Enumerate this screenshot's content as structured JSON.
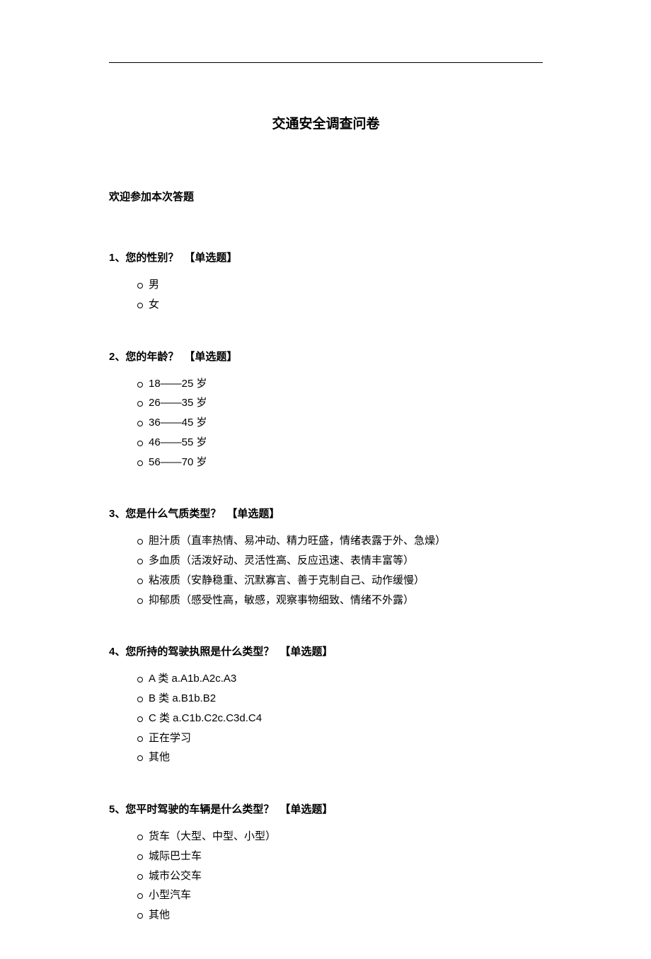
{
  "title": "交通安全调查问卷",
  "intro": "欢迎参加本次答题",
  "questions": [
    {
      "number": "1、",
      "text": "您的性别？",
      "tag": "【单选题】",
      "options": [
        "男",
        "女"
      ]
    },
    {
      "number": "2、",
      "text": "您的年龄？",
      "tag": "【单选题】",
      "options": [
        "18——25 岁",
        "26——35 岁",
        "36——45 岁",
        "46——55 岁",
        "56——70 岁"
      ]
    },
    {
      "number": "3、",
      "text": "您是什么气质类型？",
      "tag": "【单选题】",
      "options": [
        "胆汁质（直率热情、易冲动、精力旺盛，情绪表露于外、急燥）",
        "多血质（活泼好动、灵活性高、反应迅速、表情丰富等）",
        "粘液质（安静稳重、沉默寡言、善于克制自己、动作缓慢）",
        "抑郁质（感受性高，敏感，观察事物细致、情绪不外露）"
      ]
    },
    {
      "number": "4、",
      "text": "您所持的驾驶执照是什么类型？",
      "tag": "【单选题】",
      "options": [
        "A 类 a.A1b.A2c.A3",
        "B 类 a.B1b.B2",
        "C 类 a.C1b.C2c.C3d.C4",
        "正在学习",
        "其他"
      ]
    },
    {
      "number": "5、",
      "text": "您平时驾驶的车辆是什么类型？",
      "tag": "【单选题】",
      "options": [
        "货车（大型、中型、小型）",
        "城际巴士车",
        "城市公交车",
        "小型汽车",
        "其他"
      ]
    }
  ]
}
